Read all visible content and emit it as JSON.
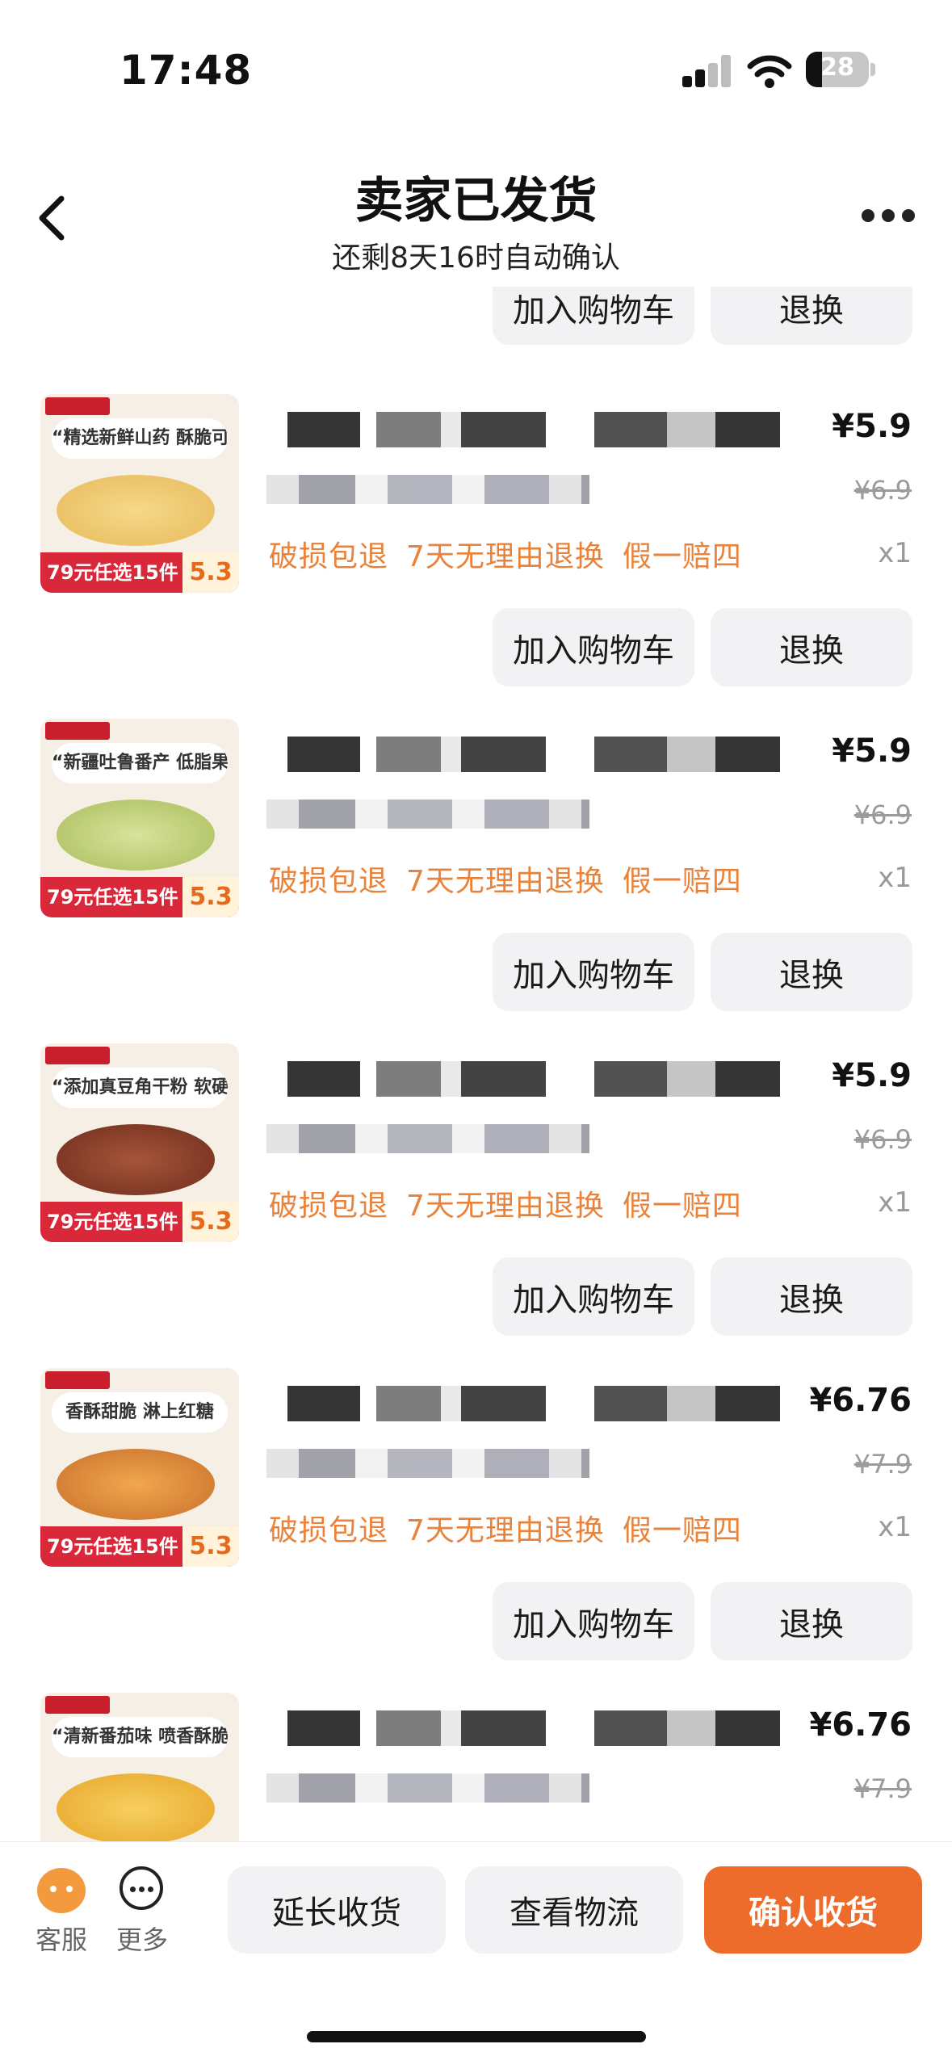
{
  "status_bar": {
    "time": "17:48",
    "battery": "28"
  },
  "header": {
    "title": "卖家已发货",
    "subtitle": "还剩8天16时自动确认"
  },
  "item_actions": {
    "add_to_cart": "加入购物车",
    "return_exchange": "退换"
  },
  "items": [
    {
      "thumb_caption": "“精选新鲜山药 酥脆可口”",
      "banner": "79元任选15件",
      "banner_price": "5.3",
      "price": "¥5.9",
      "original_price": "¥6.9",
      "tags": [
        "破损包退",
        "7天无理由退换",
        "假一赔四"
      ],
      "qty": "x1"
    },
    {
      "thumb_caption": "“新疆吐鲁番产 低脂果味甜”",
      "banner": "79元任选15件",
      "banner_price": "5.3",
      "price": "¥5.9",
      "original_price": "¥6.9",
      "tags": [
        "破损包退",
        "7天无理由退换",
        "假一赔四"
      ],
      "qty": "x1"
    },
    {
      "thumb_caption": "“添加真豆角干粉 软硬适中”",
      "banner": "79元任选15件",
      "banner_price": "5.3",
      "price": "¥5.9",
      "original_price": "¥6.9",
      "tags": [
        "破损包退",
        "7天无理由退换",
        "假一赔四"
      ],
      "qty": "x1"
    },
    {
      "thumb_caption": "香酥甜脆 淋上红糖",
      "banner": "79元任选15件",
      "banner_price": "5.3",
      "price": "¥6.76",
      "original_price": "¥7.9",
      "tags": [
        "破损包退",
        "7天无理由退换",
        "假一赔四"
      ],
      "qty": "x1"
    },
    {
      "thumb_caption": "“清新番茄味 喷香酥脆”",
      "banner": "",
      "banner_price": "",
      "price": "¥6.76",
      "original_price": "¥7.9",
      "tags": [],
      "qty": ""
    }
  ],
  "bottom_bar": {
    "customer_service": "客服",
    "more": "更多",
    "extend": "延长收货",
    "logistics": "查看物流",
    "confirm": "确认收货"
  },
  "colors": {
    "accent": "#ed6b2b",
    "tag": "#e9823a"
  }
}
